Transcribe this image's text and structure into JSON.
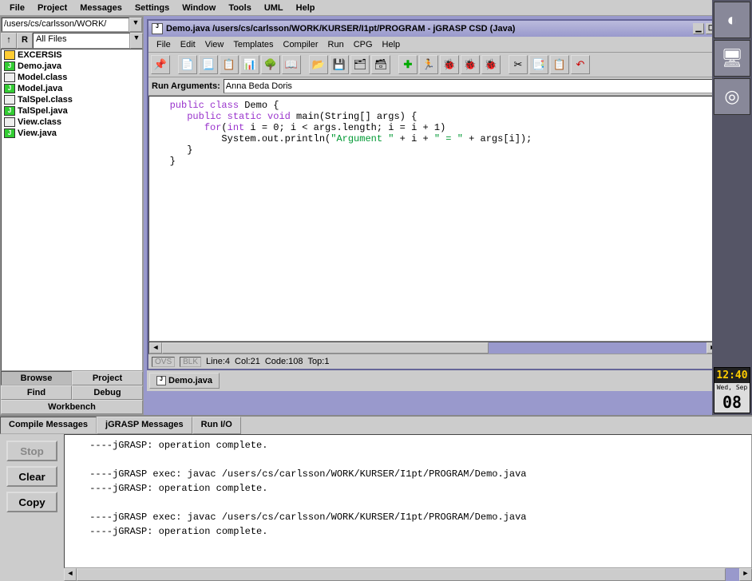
{
  "main_menu": [
    "File",
    "Project",
    "Messages",
    "Settings",
    "Window",
    "Tools",
    "UML",
    "Help"
  ],
  "left": {
    "path": "/users/cs/carlsson/WORK/",
    "up_btn": "↑",
    "r_btn": "R",
    "filter": "All Files",
    "files": [
      {
        "name": "EXCERSIS",
        "type": "folder"
      },
      {
        "name": "Demo.java",
        "type": "java"
      },
      {
        "name": "Model.class",
        "type": "class"
      },
      {
        "name": "Model.java",
        "type": "java"
      },
      {
        "name": "TalSpel.class",
        "type": "class"
      },
      {
        "name": "TalSpel.java",
        "type": "java"
      },
      {
        "name": "View.class",
        "type": "class"
      },
      {
        "name": "View.java",
        "type": "java"
      }
    ],
    "tabs": [
      "Browse",
      "Project",
      "Find",
      "Debug",
      "Workbench"
    ]
  },
  "editor": {
    "title": "Demo.java  /users/cs/carlsson/WORK/KURSER/I1pt/PROGRAM - jGRASP CSD (Java)",
    "menu": [
      "File",
      "Edit",
      "View",
      "Templates",
      "Compiler",
      "Run",
      "CPG",
      "Help"
    ],
    "run_args_label": "Run Arguments:",
    "run_args": "Anna Beda Doris",
    "status": {
      "ovs": "OVS",
      "blk": "BLK",
      "line": "Line:4",
      "col": "Col:21",
      "code": "Code:108",
      "top": "Top:1"
    },
    "doc_tab": "Demo.java",
    "code_tokens": [
      {
        "t": "   ",
        "c": ""
      },
      {
        "t": "public class",
        "c": "kw-purple"
      },
      {
        "t": " Demo {\n",
        "c": ""
      },
      {
        "t": "      ",
        "c": ""
      },
      {
        "t": "public static void",
        "c": "kw-purple"
      },
      {
        "t": " main(String[] args) {\n",
        "c": ""
      },
      {
        "t": "         ",
        "c": ""
      },
      {
        "t": "for",
        "c": "kw-purple"
      },
      {
        "t": "(",
        "c": ""
      },
      {
        "t": "int",
        "c": "kw-purple"
      },
      {
        "t": " i = 0; i < args.length; i = i + 1)\n",
        "c": ""
      },
      {
        "t": "            System.out.println(",
        "c": ""
      },
      {
        "t": "\"Argument \"",
        "c": "kw-str"
      },
      {
        "t": " + i + ",
        "c": ""
      },
      {
        "t": "\" = \"",
        "c": "kw-str"
      },
      {
        "t": " + args[i]);\n",
        "c": ""
      },
      {
        "t": "      }\n",
        "c": ""
      },
      {
        "t": "   }\n",
        "c": ""
      }
    ]
  },
  "bottom": {
    "tabs": [
      "Compile Messages",
      "jGRASP Messages",
      "Run I/O"
    ],
    "buttons": {
      "stop": "Stop",
      "clear": "Clear",
      "copy": "Copy"
    },
    "lines": [
      " ----jGRASP: operation complete.",
      "",
      " ----jGRASP exec: javac /users/cs/carlsson/WORK/KURSER/I1pt/PROGRAM/Demo.java",
      " ----jGRASP: operation complete.",
      "",
      " ----jGRASP exec: javac /users/cs/carlsson/WORK/KURSER/I1pt/PROGRAM/Demo.java",
      " ----jGRASP: operation complete."
    ]
  },
  "clock": {
    "time": "12:40",
    "weekday": "Wed, Sep",
    "day": "08"
  }
}
